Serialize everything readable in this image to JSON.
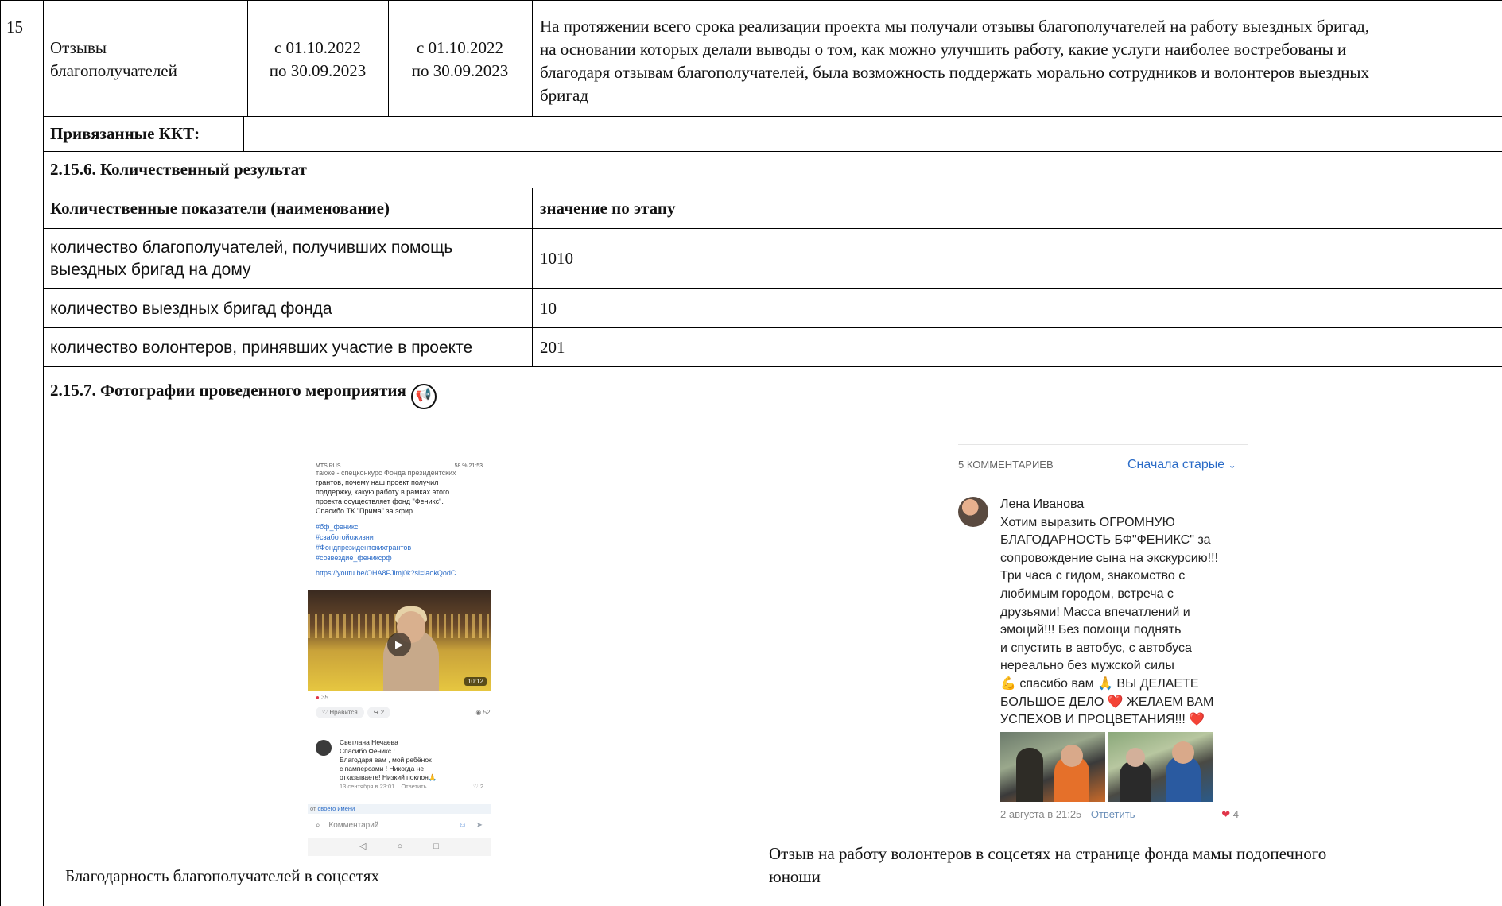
{
  "row15": {
    "number": "15",
    "name_lines": [
      "Отзывы",
      "благополучателей"
    ],
    "start_lines": [
      "с 01.10.2022",
      "по 30.09.2023"
    ],
    "end_lines": [
      "с 01.10.2022",
      "по 30.09.2023"
    ],
    "description_lines": [
      "На протяжении всего срока реализации проекта мы получали отзывы благополучателей на работу выездных бригад,",
      "на основании которых делали выводы о том, как можно улучшить работу, какие услуги наиболее востребованы и",
      "благодаря отзывам благополучателей, была возможность поддержать морально сотрудников и волонтеров выездных",
      "бригад"
    ]
  },
  "linked_label": "Привязанные ККТ:",
  "section_quant": {
    "title": "2.15.6. Количественный результат",
    "header_name": "Количественные показатели (наименование)",
    "header_value": "значение по этапу",
    "rows": [
      {
        "name_lines": [
          "количество благополучателей, получивших помощь",
          "выездных бригад на дому"
        ],
        "value": "1010"
      },
      {
        "name_lines": [
          "количество выездных бригад фонда"
        ],
        "value": "10"
      },
      {
        "name_lines": [
          "количество волонтеров, принявших участие в проекте"
        ],
        "value": "201"
      }
    ]
  },
  "section_photos": {
    "title": "2.15.7. Фотографии проведенного мероприятия",
    "icon": "megaphone-icon",
    "caption_left": "Благодарность благополучателей в соцсетях",
    "caption_right_lines": [
      "Отзыв на работу волонтеров в соцсетях на странице фонда мамы подопечного",
      "юноши"
    ]
  },
  "screenshot_left": {
    "status_left": "MTS RUS",
    "status_right": "58 % 21:53",
    "post_lines": [
      "также - спецконкурс Фонда президентских",
      "грантов, почему наш проект получил",
      "поддержку, какую работу в рамках этого",
      "проекта осуществляет фонд \"Феникс\".",
      "Спасибо ТК \"Прима\" за эфир."
    ],
    "hashtags": [
      "#бф_феникс",
      "#сзаботойожизни",
      "#Фондпрезидентскихгрантов",
      "#созвездие_фениксрф"
    ],
    "link": "https://youtu.be/OHA8FJlmj0k?si=laokQodC...",
    "video_duration": "10:12",
    "likes": "35",
    "like_label": "Нравится",
    "shares": "2",
    "views": "521",
    "comment_author": "Светлана Нечаева",
    "comment_lines": [
      "Спасибо Феникс !",
      "Благодаря вам , мой ребёнок",
      "с памперсами ! Никогда не",
      "отказываете! Низкий поклон🙏"
    ],
    "comment_date": "13 сентября в 23:01",
    "reply_label": "Ответить",
    "comment_likes": "2",
    "from_prefix": "от",
    "from_name": "своего имени",
    "input_placeholder": "Комментарий"
  },
  "screenshot_right": {
    "comments_count": "5 КОММЕНТАРИЕВ",
    "sort_label": "Сначала старые",
    "author": "Лена Иванова",
    "text_lines": [
      "Хотим выразить ОГРОМНУЮ",
      "БЛАГОДАРНОСТЬ БФ\"ФЕНИКС\" за",
      "сопровождение сына на экскурсию!!!",
      "Три часа с гидом, знакомство с",
      "любимым городом, встреча с",
      "друзьями! Масса впечатлений и",
      "эмоций!!! Без помощи поднять",
      "и спустить в автобус, с автобуса",
      "нереально без мужской силы",
      "💪 спасибо вам 🙏 ВЫ ДЕЛАЕТЕ",
      "БОЛЬШОЕ ДЕЛО ❤️ ЖЕЛАЕМ ВАМ",
      "УСПЕХОВ И ПРОЦВЕТАНИЯ!!! ❤️"
    ],
    "date": "2 августа в 21:25",
    "reply_label": "Ответить",
    "likes": "4"
  },
  "colors": {
    "link_blue": "#2a6bc7",
    "heart_red": "#e0364a"
  }
}
